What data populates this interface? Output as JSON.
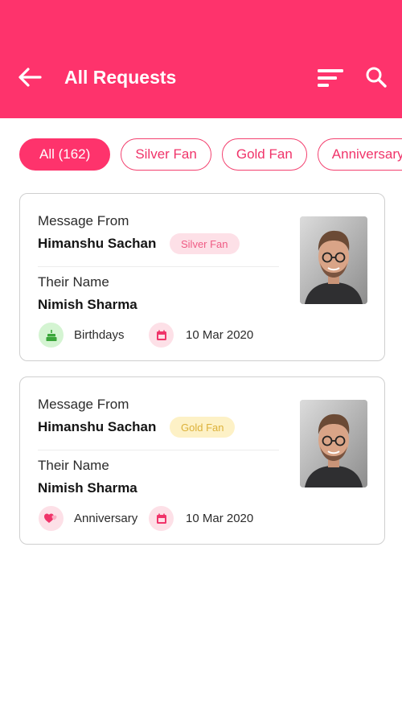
{
  "header": {
    "title": "All Requests",
    "background_color": "#fe336c",
    "icons": [
      "back-arrow-icon",
      "filter-sort-icon",
      "search-icon"
    ]
  },
  "filters": [
    {
      "label": "All (162)",
      "selected": true
    },
    {
      "label": "Silver Fan",
      "selected": false
    },
    {
      "label": "Gold Fan",
      "selected": false
    },
    {
      "label": "Anniversary",
      "selected": false
    }
  ],
  "requests": [
    {
      "message_from_label": "Message From",
      "sender_name": "Himanshu Sachan",
      "fan_tier": "Silver Fan",
      "their_name_label": "Their Name",
      "recipient_name": "Nimish Sharma",
      "occasion": "Birthdays",
      "occasion_icon": "birthday-cake-icon",
      "date": "10 Mar 2020",
      "date_icon": "calendar-icon"
    },
    {
      "message_from_label": "Message From",
      "sender_name": "Himanshu Sachan",
      "fan_tier": "Gold Fan",
      "their_name_label": "Their Name",
      "recipient_name": "Nimish Sharma",
      "occasion": "Anniversary",
      "occasion_icon": "hearts-icon",
      "date": "10 Mar 2020",
      "date_icon": "calendar-icon"
    }
  ]
}
